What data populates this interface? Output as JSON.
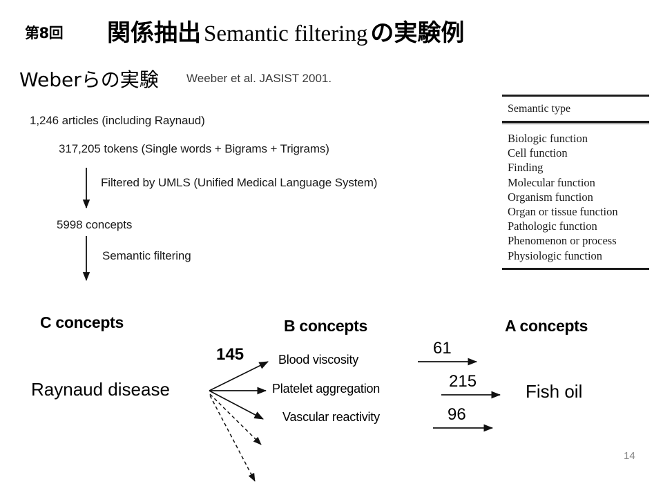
{
  "slide": {
    "lecture_badge": "第8回",
    "title_jp_1": "関係抽出",
    "title_en": "Semantic filtering",
    "title_jp_2": "の実験例",
    "page_number": "14"
  },
  "section": {
    "heading_jp": "Weberらの実験",
    "citation": "Weeber et al. JASIST 2001."
  },
  "flow": {
    "articles": "1,246 articles (including Raynaud)",
    "tokens": "317,205 tokens (Single words + Bigrams + Trigrams)",
    "umls_step": "Filtered by UMLS (Unified Medical Language System)",
    "concepts": "5998 concepts",
    "semantic_filtering_step": "Semantic filtering"
  },
  "semantic_table": {
    "header": "Semantic type",
    "rows": [
      "Biologic function",
      "Cell function",
      "Finding",
      "Molecular function",
      "Organism function",
      "Organ or tissue function",
      "Pathologic function",
      "Phenomenon or process",
      "Physiologic function"
    ]
  },
  "abc_diagram": {
    "column_c_heading": "C concepts",
    "column_b_heading": "B concepts",
    "column_a_heading": "A concepts",
    "c_term": "Raynaud disease",
    "a_term": "Fish oil",
    "b_terms": [
      "Blood viscosity",
      "Platelet aggregation",
      "Vascular reactivity"
    ],
    "weight_c_to_b": "145",
    "weights_b_to_a": [
      "61",
      "215",
      "96"
    ]
  },
  "colors": {
    "text": "#000000",
    "muted_text": "#3a3a3a",
    "rule": "#1b1b1b",
    "page_number": "#8a8a8a",
    "background": "#ffffff"
  }
}
